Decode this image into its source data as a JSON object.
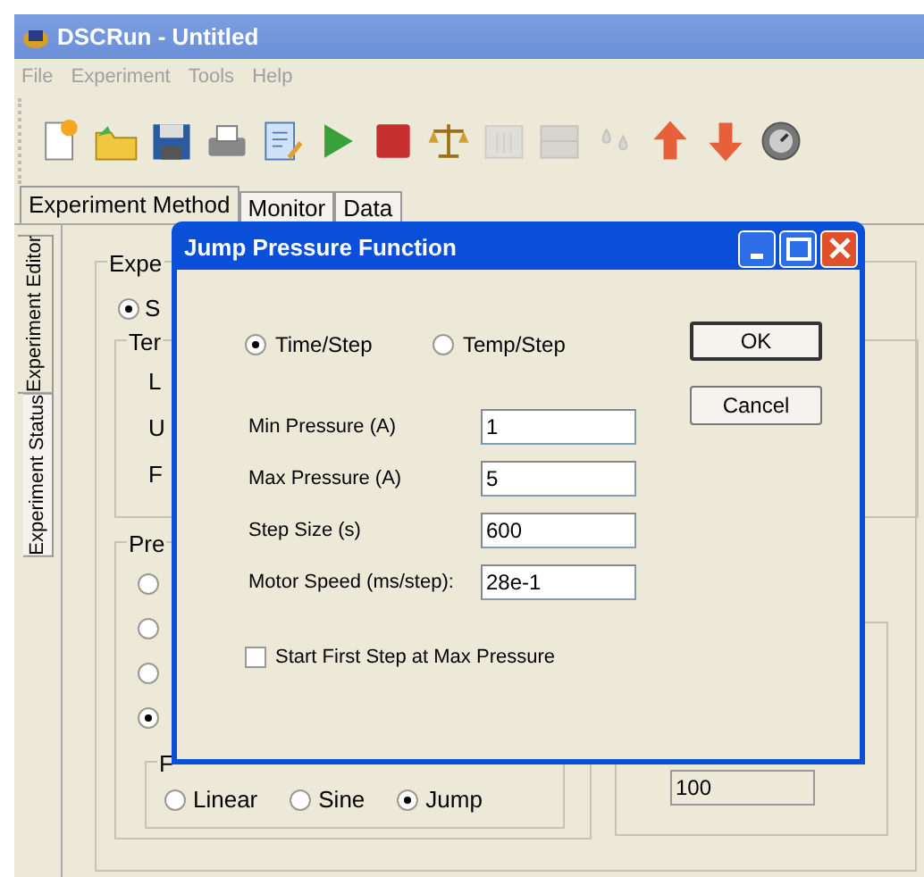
{
  "window": {
    "title": "DSCRun - Untitled"
  },
  "menu": [
    {
      "label": "File",
      "disabled": true
    },
    {
      "label": "Experiment",
      "disabled": true
    },
    {
      "label": "Tools",
      "disabled": true
    },
    {
      "label": "Help",
      "disabled": true
    }
  ],
  "toolbar": [
    {
      "kind": "new",
      "disabled": false
    },
    {
      "kind": "open",
      "disabled": false
    },
    {
      "kind": "save",
      "disabled": false
    },
    {
      "kind": "print",
      "disabled": false
    },
    {
      "kind": "edit",
      "disabled": false
    },
    {
      "kind": "play",
      "disabled": false
    },
    {
      "kind": "stop",
      "disabled": false
    },
    {
      "kind": "scale",
      "disabled": false
    },
    {
      "kind": "grid",
      "disabled": true
    },
    {
      "kind": "panel",
      "disabled": true
    },
    {
      "kind": "drops",
      "disabled": true
    },
    {
      "kind": "up",
      "disabled": false
    },
    {
      "kind": "down",
      "disabled": false
    },
    {
      "kind": "gauge",
      "disabled": false
    }
  ],
  "tabs": [
    {
      "label": "Experiment Method",
      "selected": true
    },
    {
      "label": "Monitor",
      "selected": false
    },
    {
      "label": "Data",
      "selected": false
    }
  ],
  "side_tabs": [
    {
      "label": "Experiment Editor",
      "selected": true
    },
    {
      "label": "Experiment Status",
      "selected": false
    }
  ],
  "editor": {
    "group_label": "Expe",
    "mode_radio": {
      "label": "S",
      "selected": true
    },
    "temperature_group": {
      "label": "Ter",
      "rows": [
        "L",
        "U",
        "F"
      ]
    },
    "pressure_group": {
      "label": "Pre",
      "options": [
        {
          "selected": false
        },
        {
          "selected": false
        },
        {
          "selected": false
        },
        {
          "selected": true
        }
      ],
      "function_group": {
        "label": "F",
        "options": [
          {
            "label": "Linear",
            "selected": false
          },
          {
            "label": "Sine",
            "selected": false
          },
          {
            "label": "Jump",
            "selected": true
          }
        ]
      }
    },
    "right_field": {
      "value": "100"
    }
  },
  "dialog": {
    "title": "Jump Pressure Function",
    "modes": [
      {
        "label": "Time/Step",
        "selected": true
      },
      {
        "label": "Temp/Step",
        "selected": false
      }
    ],
    "fields": [
      {
        "label": "Min Pressure (A)",
        "value": "1"
      },
      {
        "label": "Max Pressure (A)",
        "value": "5"
      },
      {
        "label": "Step Size (s)",
        "value": "600"
      },
      {
        "label": "Motor Speed (ms/step):",
        "value": "28e-1"
      }
    ],
    "checkbox": {
      "label": "Start First Step at Max Pressure",
      "checked": false
    },
    "buttons": [
      {
        "label": "OK",
        "default": true
      },
      {
        "label": "Cancel",
        "default": false
      }
    ]
  }
}
